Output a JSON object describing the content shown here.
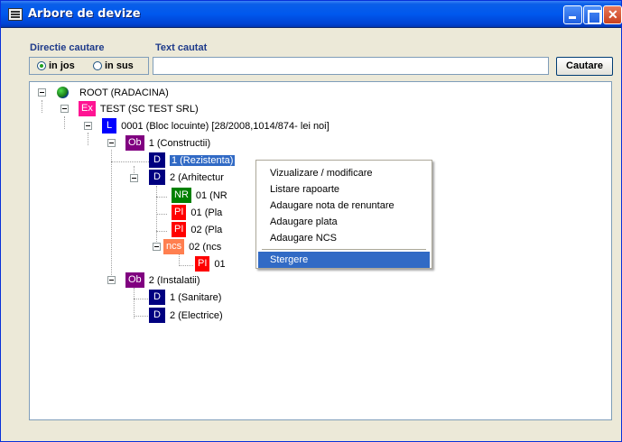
{
  "window": {
    "title": "Arbore de devize"
  },
  "search": {
    "direction_label": "Directie cautare",
    "text_label": "Text cautat",
    "option_down": "in jos",
    "option_up": "in sus",
    "selected": "in jos",
    "value": "",
    "button_label": "Cautare"
  },
  "tree": [
    {
      "badge": "",
      "label": "ROOT (RADACINA)",
      "color": "#1a7a1a"
    },
    {
      "badge": "Ex",
      "label": "TEST (SC TEST SRL)",
      "color": "#ff1493"
    },
    {
      "badge": "L",
      "label": "0001 (Bloc locuinte) [28/2008,1014/874- lei noi]",
      "color": "#0000ff"
    },
    {
      "badge": "Ob",
      "label": "1 (Constructii)",
      "color": "#800080"
    },
    {
      "badge": "D",
      "label": "1 (Rezistenta)",
      "color": "#000080",
      "selected": true
    },
    {
      "badge": "D",
      "label": "2 (Arhitectur",
      "color": "#000080"
    },
    {
      "badge": "NR",
      "label": "01 (NR",
      "color": "#008000"
    },
    {
      "badge": "PI",
      "label": "01 (Pla",
      "color": "#ff0000"
    },
    {
      "badge": "PI",
      "label": "02 (Pla",
      "color": "#ff0000"
    },
    {
      "badge": "ncs",
      "label": "02 (ncs",
      "color": "#ff7f50"
    },
    {
      "badge": "PI",
      "label": "01",
      "color": "#ff0000"
    },
    {
      "badge": "Ob",
      "label": "2 (Instalatii)",
      "color": "#800080"
    },
    {
      "badge": "D",
      "label": "1 (Sanitare)",
      "color": "#000080"
    },
    {
      "badge": "D",
      "label": "2 (Electrice)",
      "color": "#000080"
    }
  ],
  "context_menu": {
    "items": [
      "Vizualizare / modificare",
      "Listare rapoarte",
      "Adaugare nota de renuntare",
      "Adaugare plata",
      "Adaugare NCS",
      "Stergere"
    ],
    "highlighted": "Stergere"
  }
}
